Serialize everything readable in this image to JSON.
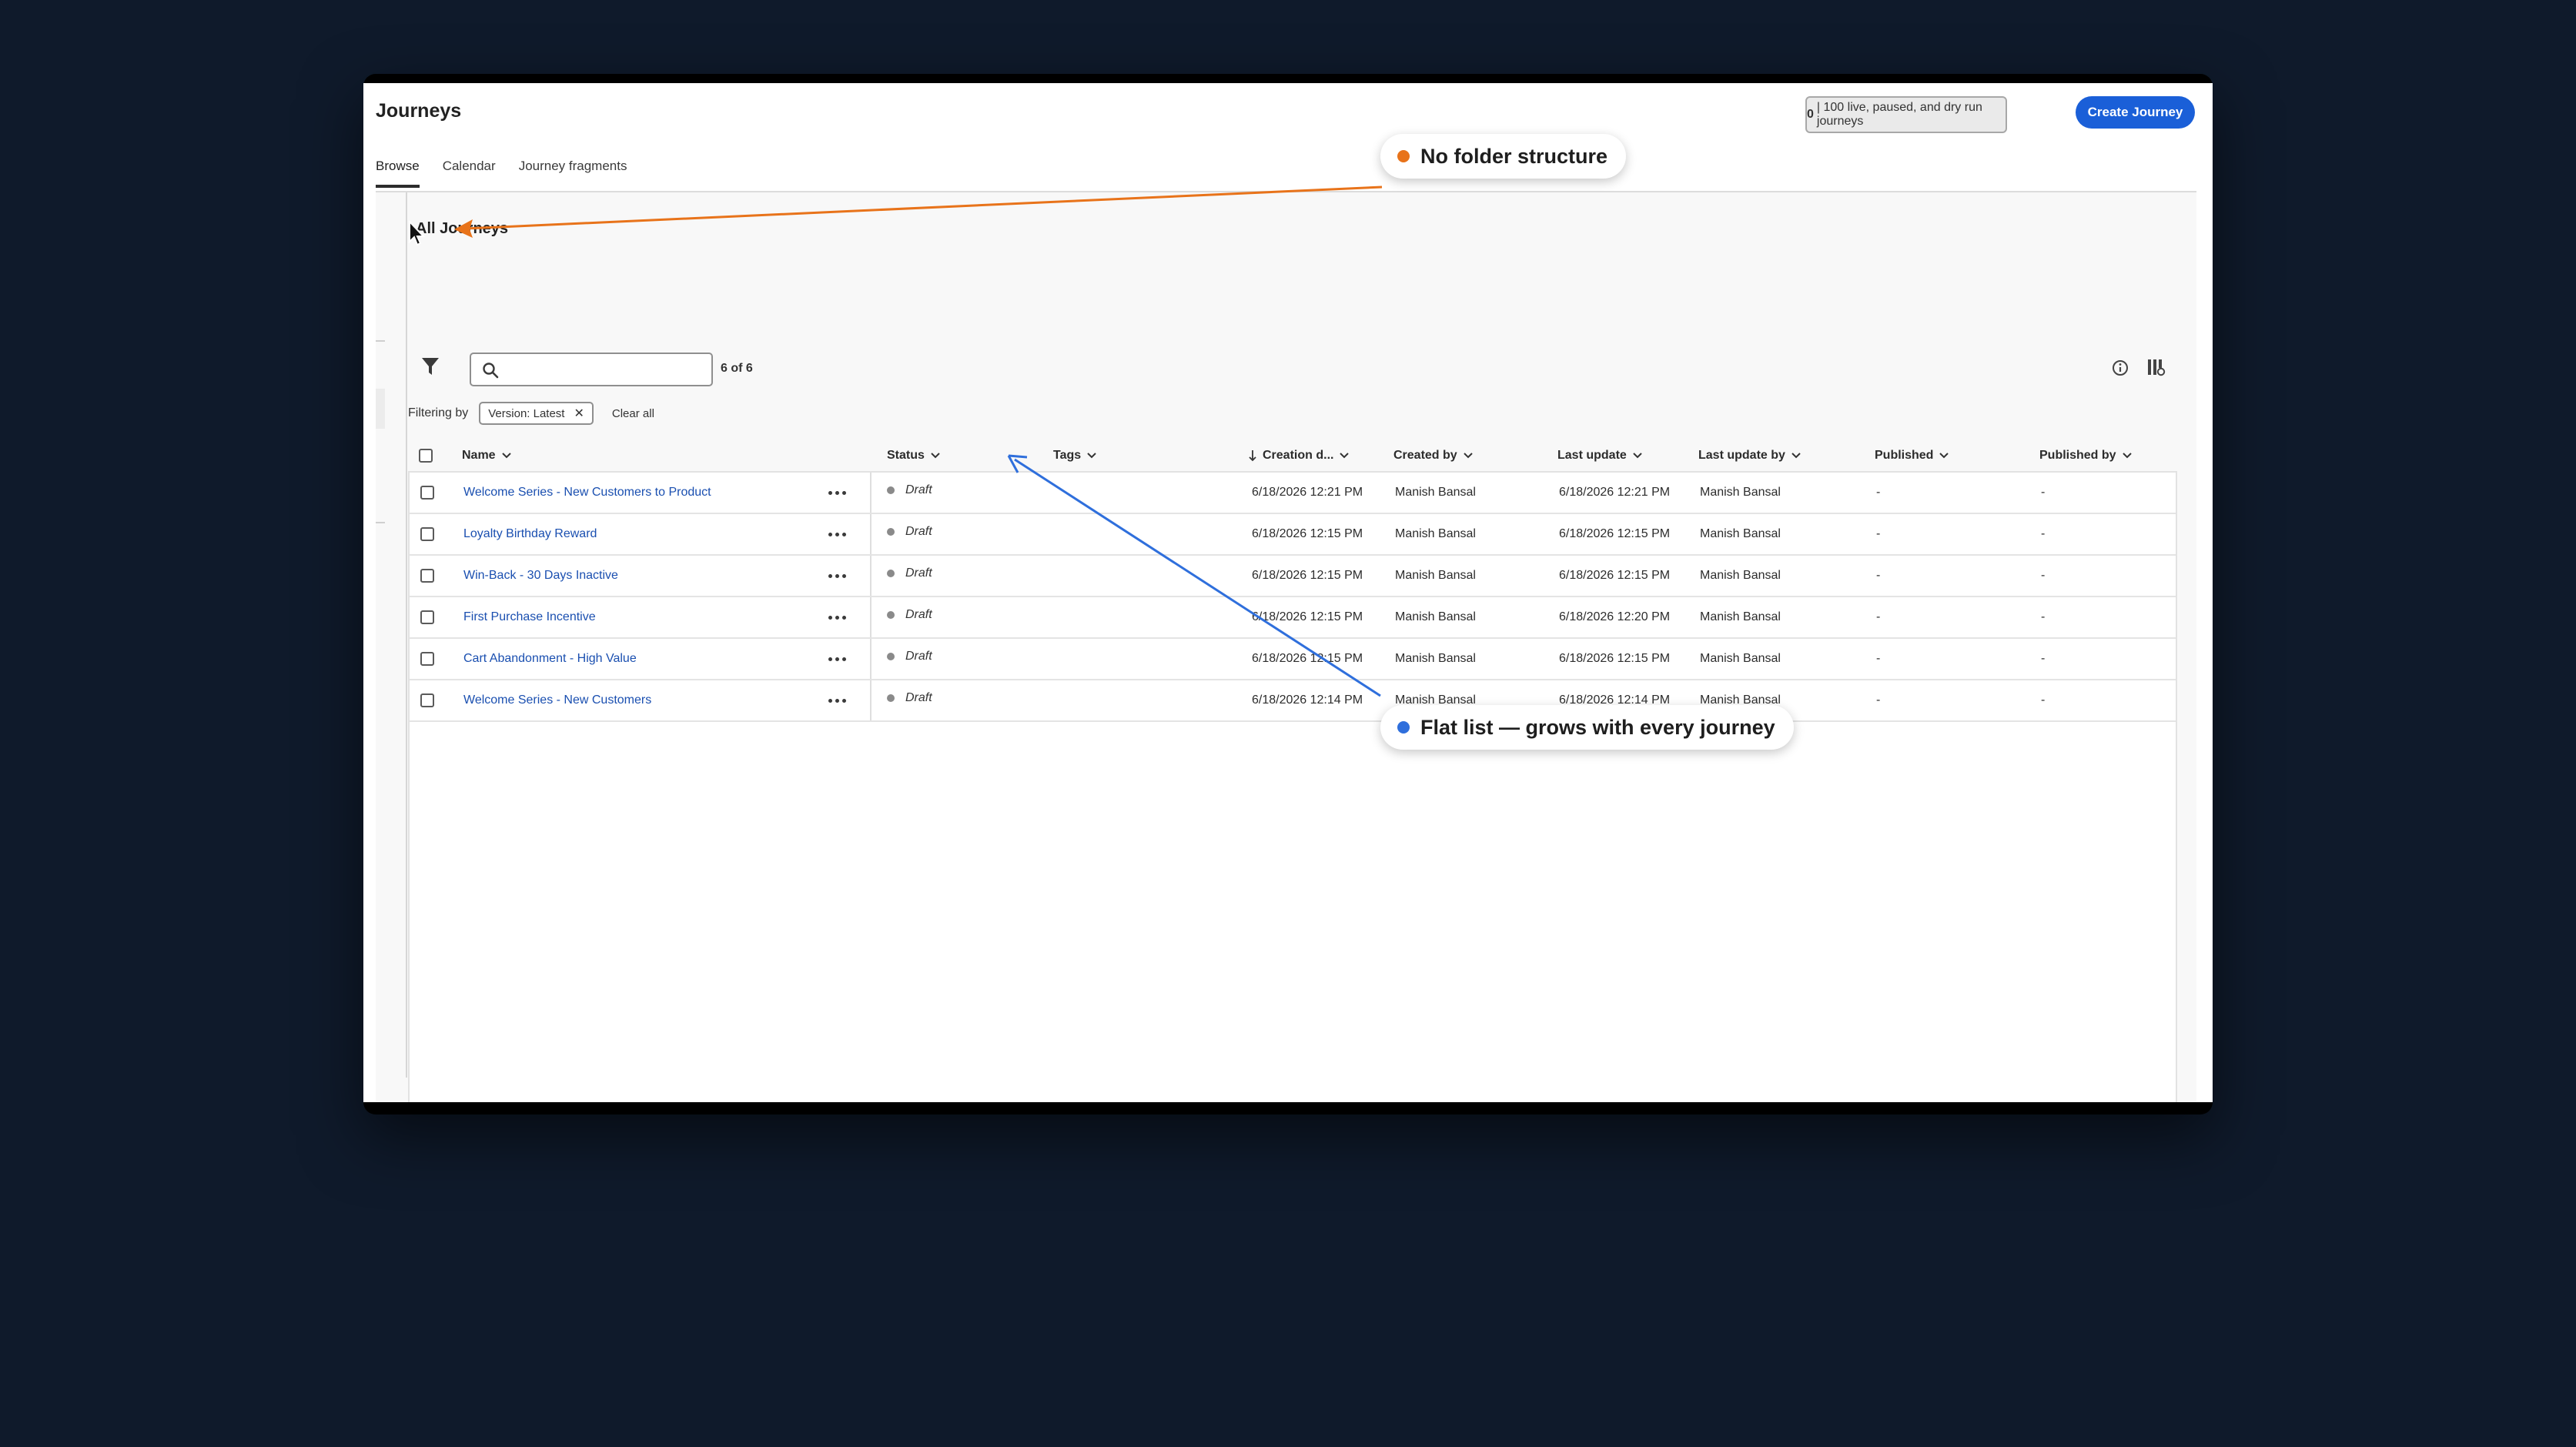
{
  "window": {
    "title": "Journeys",
    "quota": {
      "count": "0",
      "text": "| 100 live, paused, and dry run journeys"
    },
    "create_button": "Create Journey"
  },
  "tabs": [
    {
      "label": "Browse",
      "active": true
    },
    {
      "label": "Calendar",
      "active": false
    },
    {
      "label": "Journey fragments",
      "active": false
    }
  ],
  "folder": {
    "title": "All Journeys"
  },
  "toolbar": {
    "search_placeholder": "",
    "result_count": "6 of 6",
    "filter_icon": "filter-icon",
    "info_icon": "info-icon",
    "columns_icon": "column-settings-icon"
  },
  "filters": {
    "label": "Filtering by",
    "chips": [
      {
        "label": "Version: Latest"
      }
    ],
    "clear_all": "Clear all"
  },
  "table": {
    "columns": {
      "name": "Name",
      "status": "Status",
      "tags": "Tags",
      "creation_date": "Creation d...",
      "created_by": "Created by",
      "last_update": "Last update",
      "last_update_by": "Last update by",
      "published": "Published",
      "published_by": "Published by"
    },
    "sort": {
      "column": "creation_date",
      "direction": "descending"
    },
    "rows": [
      {
        "name": "Welcome Series - New Customers to Product",
        "status": "Draft",
        "tags": "",
        "creation_date": "6/18/2026 12:21 PM",
        "created_by": "Manish Bansal",
        "last_update": "6/18/2026 12:21 PM",
        "last_update_by": "Manish Bansal",
        "published": "-",
        "published_by": "-"
      },
      {
        "name": "Loyalty Birthday Reward",
        "status": "Draft",
        "tags": "",
        "creation_date": "6/18/2026 12:15 PM",
        "created_by": "Manish Bansal",
        "last_update": "6/18/2026 12:15 PM",
        "last_update_by": "Manish Bansal",
        "published": "-",
        "published_by": "-"
      },
      {
        "name": "Win-Back - 30 Days Inactive",
        "status": "Draft",
        "tags": "",
        "creation_date": "6/18/2026 12:15 PM",
        "created_by": "Manish Bansal",
        "last_update": "6/18/2026 12:15 PM",
        "last_update_by": "Manish Bansal",
        "published": "-",
        "published_by": "-"
      },
      {
        "name": "First Purchase Incentive",
        "status": "Draft",
        "tags": "",
        "creation_date": "6/18/2026 12:15 PM",
        "created_by": "Manish Bansal",
        "last_update": "6/18/2026 12:20 PM",
        "last_update_by": "Manish Bansal",
        "published": "-",
        "published_by": "-"
      },
      {
        "name": "Cart Abandonment - High Value",
        "status": "Draft",
        "tags": "",
        "creation_date": "6/18/2026 12:15 PM",
        "created_by": "Manish Bansal",
        "last_update": "6/18/2026 12:15 PM",
        "last_update_by": "Manish Bansal",
        "published": "-",
        "published_by": "-"
      },
      {
        "name": "Welcome Series - New Customers",
        "status": "Draft",
        "tags": "",
        "creation_date": "6/18/2026 12:14 PM",
        "created_by": "Manish Bansal",
        "last_update": "6/18/2026 12:14 PM",
        "last_update_by": "Manish Bansal",
        "published": "-",
        "published_by": "-"
      }
    ]
  },
  "annotations": [
    {
      "text": "No folder structure",
      "color": "#e8731a"
    },
    {
      "text": "Flat list — grows with every journey",
      "color": "#2f6fdc"
    }
  ],
  "colors": {
    "background": "#0f1a2b",
    "accent": "#1a5fd8",
    "link": "#1a4fb0",
    "status_draft": "#8a8a8a"
  }
}
